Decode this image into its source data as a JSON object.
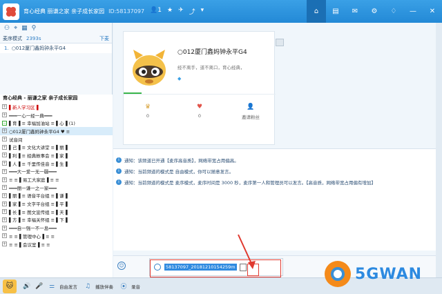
{
  "titlebar": {
    "title": "育心经典 丽谦之家 亲子成长家园",
    "room_id": "ID:58137097",
    "user_count": "1",
    "nav": [
      "home",
      "list",
      "gift",
      "settings",
      "skin",
      "minimize",
      "close"
    ]
  },
  "sidebar": {
    "mic_mode_label": "麦序模式",
    "mic_count": "2393s",
    "next_label": "下麦",
    "queue_number": "1.",
    "queue_user": "○012厦门鑫妈钟永平G4",
    "channel_title": "育心经典 - 丽谦之家 亲子成长家园",
    "tree": [
      {
        "text": "▌新人学习区▐",
        "style": "red"
      },
      {
        "text": "━━━一心一经一典━━━",
        "style": ""
      },
      {
        "text": "▌育▐ ≡ 幸福加油站 ≡ ▌心▐ (1)",
        "style": "green"
      },
      {
        "text": "○012厦门鑫妈钟永平G4 ♥ ≡",
        "style": "sel"
      },
      {
        "text": "试音间",
        "style": ""
      },
      {
        "text": "▌己▐ ≡ 文化大讲堂 ≡ ▌丽▐",
        "style": ""
      },
      {
        "text": "▌利▐ ≡ 经典故事会 ≡ ▌家▐",
        "style": ""
      },
      {
        "text": "▌人▐ ≡ 千里传佳音 ≡ ▌生▐",
        "style": ""
      },
      {
        "text": "━━━大一爱一无一疆━━━",
        "style": ""
      },
      {
        "text": "≡ ≡ ▌易工大家庭▐ ≡ ≡",
        "style": ""
      },
      {
        "text": "━━━丽一谦一之一家━━━",
        "style": ""
      },
      {
        "text": "▌丽▐ ≡ 语音平台组 ≡ ▌谦▐",
        "style": ""
      },
      {
        "text": "▌家▐ ≡ 文字平台组 ≡ ▌平▐",
        "style": ""
      },
      {
        "text": "▌长▐ ≡ 图文宣传组 ≡ ▌天▐",
        "style": ""
      },
      {
        "text": "▌方▐ ≡ 幸福关怀组 ≡ ▌下▐",
        "style": ""
      },
      {
        "text": "━━━自一强一不一息━━━",
        "style": ""
      },
      {
        "text": "≡ ≡ ▌管理中心▐ ≡ ≡",
        "style": ""
      },
      {
        "text": "≡ ≡ ▌会议室▐ ≡ ≡",
        "style": ""
      }
    ]
  },
  "profile": {
    "name": "○012厦门鑫妈钟永平G4",
    "desc": "经不离手，道不离口，育心经典，",
    "stats": [
      {
        "icon": "trophy-icon",
        "value": "0"
      },
      {
        "icon": "heart-icon",
        "value": "0"
      },
      {
        "icon": "person-icon",
        "value": "邀请粉丝"
      }
    ]
  },
  "notices": [
    "通知：该频道已开通【麦序高音质】，网络带宽占用偏高。",
    "通知：当前频道的模式是 自由模式，你可以随意发言。",
    "通知：当前频道的模式是 麦序模式，麦序时间是 3000 秒，麦序第一人和管理员可以发言。【高音质，网络带宽占用偏有增加】"
  ],
  "input": {
    "url_text": "58137097_20181210154259m"
  },
  "bottombar": {
    "free_speech": "自由发言",
    "play_accompany": "播放伴奏",
    "record": "录音"
  },
  "watermark": "5GWAN",
  "colors": {
    "titlebar": "#2389d6",
    "highlight": "#e0392f"
  }
}
